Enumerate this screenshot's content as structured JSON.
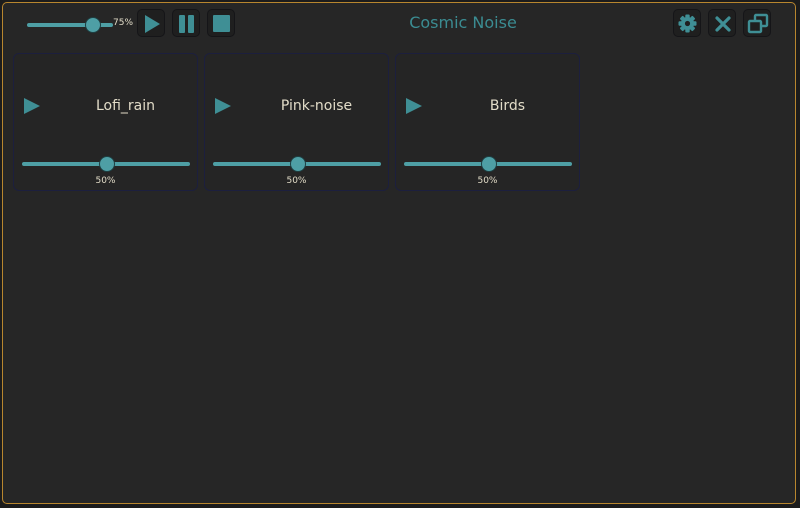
{
  "app": {
    "title": "Cosmic Noise"
  },
  "toolbar": {
    "master_volume": 0.75,
    "master_volume_label": "75%",
    "buttons": [
      "play-icon",
      "pause-icon",
      "stop-icon"
    ],
    "window_buttons": [
      "gear-icon",
      "close-icon",
      "restore-window-icon"
    ]
  },
  "sounds": [
    {
      "name": "Lofi_rain",
      "volume": 0.5,
      "volume_label": "50%"
    },
    {
      "name": "Pink-noise",
      "volume": 0.5,
      "volume_label": "50%"
    },
    {
      "name": "Birds",
      "volume": 0.5,
      "volume_label": "50%"
    }
  ],
  "colors": {
    "accent": "#4e9fa5",
    "title": "#3b8c92",
    "window_border": "#b8862e",
    "card_border": "#1c1f3e",
    "text": "#e2dcc8",
    "background": "#262626"
  }
}
